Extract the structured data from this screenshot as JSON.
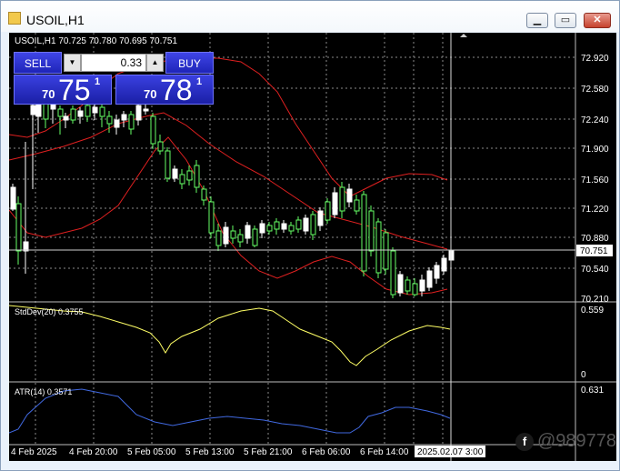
{
  "window": {
    "title": "USOIL,H1",
    "minimize_icon": "minimize-icon",
    "maximize_icon": "maximize-icon",
    "close_icon": "close-icon"
  },
  "chart": {
    "header": "USOIL,H1  70.725 70.780 70.695 70.751",
    "price_axis_labels": [
      "72.920",
      "72.580",
      "72.240",
      "71.900",
      "71.560",
      "71.220",
      "70.880",
      "70.540",
      "70.210"
    ],
    "current_price_label": "70.751",
    "time_axis_labels": [
      "4 Feb 2025",
      "4 Feb 20:00",
      "5 Feb 05:00",
      "5 Feb 13:00",
      "5 Feb 21:00",
      "6 Feb 06:00",
      "6 Feb 14:00"
    ],
    "crosshair_time_label": "2025.02.07 3:00",
    "colors": {
      "background": "#000000",
      "grid": "#8a8a8a",
      "bull_candle": "#66ff66",
      "bear_candle": "#ffffff",
      "bands": "#e02020",
      "stddev": "#ffff66",
      "atr": "#4169e1"
    }
  },
  "indicators": {
    "stddev": {
      "label": "StdDev(20) 0.3755",
      "axis_top": "0.559",
      "axis_bottom": "0"
    },
    "atr": {
      "label": "ATR(14) 0.3571",
      "axis_top": "0.631"
    }
  },
  "trade_panel": {
    "sell_label": "SELL",
    "buy_label": "BUY",
    "lot_value": "0.33",
    "lot_down_icon": "chevron-down-icon",
    "lot_up_icon": "chevron-up-icon",
    "sell_quote": {
      "small": "70",
      "big": "75",
      "sup": "1"
    },
    "buy_quote": {
      "small": "70",
      "big": "78",
      "sup": "1"
    }
  },
  "watermark": {
    "text": "@989778",
    "logo_icon": "brand-logo-icon"
  }
}
